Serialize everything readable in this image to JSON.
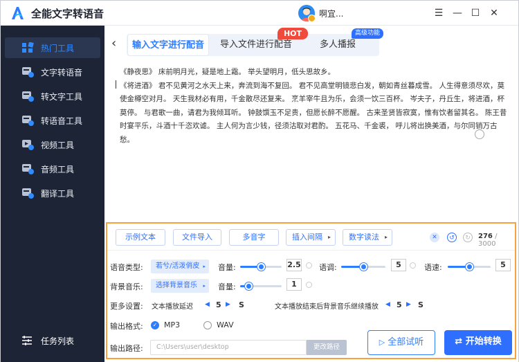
{
  "app": {
    "title": "全能文字转语音",
    "username": "啊宜...",
    "vip_badge": "V"
  },
  "window": {
    "menu": "☰",
    "min": "—",
    "max": "☐",
    "close": "✕"
  },
  "sidebar": {
    "items": [
      {
        "label": "热门工具",
        "icon": "grid-icon",
        "active": true
      },
      {
        "label": "文字转语音",
        "icon": "text-to-speech-icon"
      },
      {
        "label": "转文字工具",
        "icon": "speech-to-text-icon"
      },
      {
        "label": "转语音工具",
        "icon": "voice-tool-icon"
      },
      {
        "label": "视频工具",
        "icon": "video-icon"
      },
      {
        "label": "音频工具",
        "icon": "audio-icon"
      },
      {
        "label": "翻译工具",
        "icon": "translate-icon"
      }
    ],
    "task_list": "任务列表"
  },
  "tabs": {
    "back": "‹",
    "items": [
      "输入文字进行配音",
      "导入文件进行配音",
      "多人播报"
    ],
    "hot_badge": "HOT",
    "pro_badge": "高级功能"
  },
  "content": {
    "line1": "《静夜思》 床前明月光，疑是地上霜。 举头望明月，低头思故乡。",
    "line2": "《将进酒》 君不见黄河之水天上来，奔流到海不复回。 君不见高堂明镜悲白发，朝如青丝暮成雪。 人生得意须尽欢，莫使金樽空对月。 天生我材必有用，千金散尽还复来。 烹羊宰牛且为乐，会须一饮三百杯。 岑夫子，丹丘生，将进酒，杯莫停。 与君歌一曲，请君为我倾耳听。 钟鼓馔玉不足贵，但愿长醉不愿醒。 古来圣贤皆寂寞，惟有饮者留其名。 陈王昔时宴平乐，斗酒十千恣欢谑。 主人何为言少钱，径须沽取对君酌。 五花马、千金裘， 呼儿将出换美酒，与尔同销万古愁。"
  },
  "toolbar": {
    "buttons": [
      "示例文本",
      "文件导入",
      "多音字",
      "插入间隔",
      "数字读法"
    ],
    "arrow": "▸",
    "count": "276",
    "total": "/ 3000"
  },
  "settings": {
    "voice_type_label": "语音类型:",
    "voice_value": "若兮/活泼俏皮",
    "volume_label": "音量:",
    "volume_value": "2.5",
    "pitch_label": "语调:",
    "pitch_value": "5",
    "speed_label": "语速:",
    "speed_value": "5",
    "bgm_label": "背景音乐:",
    "bgm_value": "选择背景音乐",
    "bgm_volume_label": "音量:",
    "bgm_volume_value": "1",
    "more_label": "更多设置:",
    "delay_label": "文本播放延迟",
    "delay_value": "5",
    "delay_unit": "S",
    "after_label": "文本播放结束后背景音乐继续播放",
    "after_value": "5",
    "after_unit": "S",
    "format_label": "输出格式:",
    "format_mp3": "MP3",
    "format_wav": "WAV",
    "path_label": "输出路径:",
    "path_value": "C:\\Users\\user\\desktop",
    "change_path": "更改路径",
    "preview_btn": "全部试听",
    "start_btn": "开始转换"
  },
  "levels": {
    "volume": 0.5,
    "pitch": 0.5,
    "speed": 0.5,
    "bgm_volume": 0.2
  },
  "colors": {
    "accent": "#2f7dff",
    "sidebar": "#1c2436",
    "panel_border": "#f7a23c",
    "hot": "#f04a3c"
  }
}
